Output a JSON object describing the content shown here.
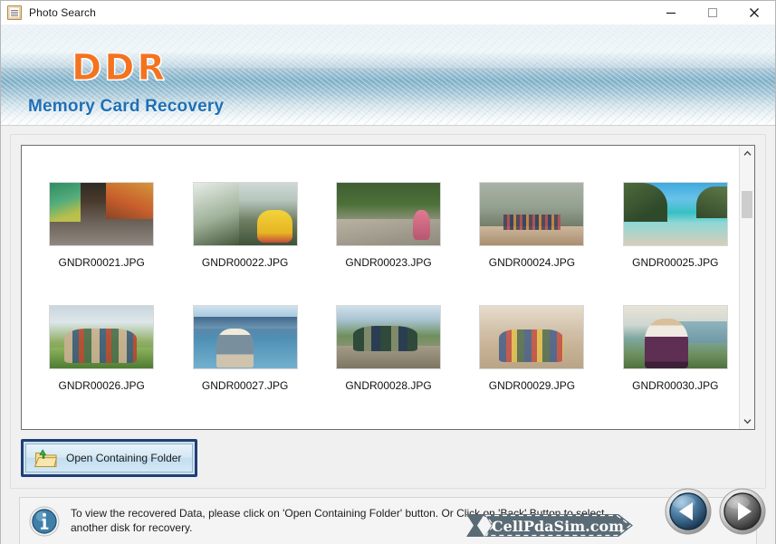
{
  "window": {
    "title": "Photo Search",
    "icon": "photo-search-app-icon",
    "controls": {
      "minimize": "minimize-icon",
      "maximize": "maximize-icon",
      "close": "close-icon"
    }
  },
  "banner": {
    "logo": "DDR",
    "subtitle": "Memory Card Recovery",
    "logo_color": "#f47320",
    "subtitle_color": "#1f6fb5"
  },
  "thumbnails": {
    "rows": [
      [
        {
          "label": "GNDR00021.JPG",
          "art": "t21"
        },
        {
          "label": "GNDR00022.JPG",
          "art": "t22"
        },
        {
          "label": "GNDR00023.JPG",
          "art": "t23"
        },
        {
          "label": "GNDR00024.JPG",
          "art": "t24"
        },
        {
          "label": "GNDR00025.JPG",
          "art": "t25"
        }
      ],
      [
        {
          "label": "GNDR00026.JPG",
          "art": "t26"
        },
        {
          "label": "GNDR00027.JPG",
          "art": "t27"
        },
        {
          "label": "GNDR00028.JPG",
          "art": "t28"
        },
        {
          "label": "GNDR00029.JPG",
          "art": "t29"
        },
        {
          "label": "GNDR00030.JPG",
          "art": "t30"
        }
      ]
    ]
  },
  "scrollbar": {
    "up_arrow": "chevron-up-icon",
    "down_arrow": "chevron-down-icon",
    "thumb_position_pct": 12
  },
  "actions": {
    "open_folder_label": "Open Containing Folder",
    "open_folder_icon": "open-folder-upload-icon",
    "focused": true
  },
  "info": {
    "icon": "information-icon",
    "message": "To view the recovered Data, please click on 'Open Containing Folder' button. Or Click on 'Back' Button to select another disk for recovery."
  },
  "watermark": {
    "text": "CellPdaSim.com",
    "color": "#5a6b75"
  },
  "navigation": {
    "back": {
      "name": "back-button",
      "icon": "triangle-left-icon",
      "state": "enabled"
    },
    "next": {
      "name": "next-button",
      "icon": "triangle-right-icon",
      "state": "disabled"
    }
  }
}
